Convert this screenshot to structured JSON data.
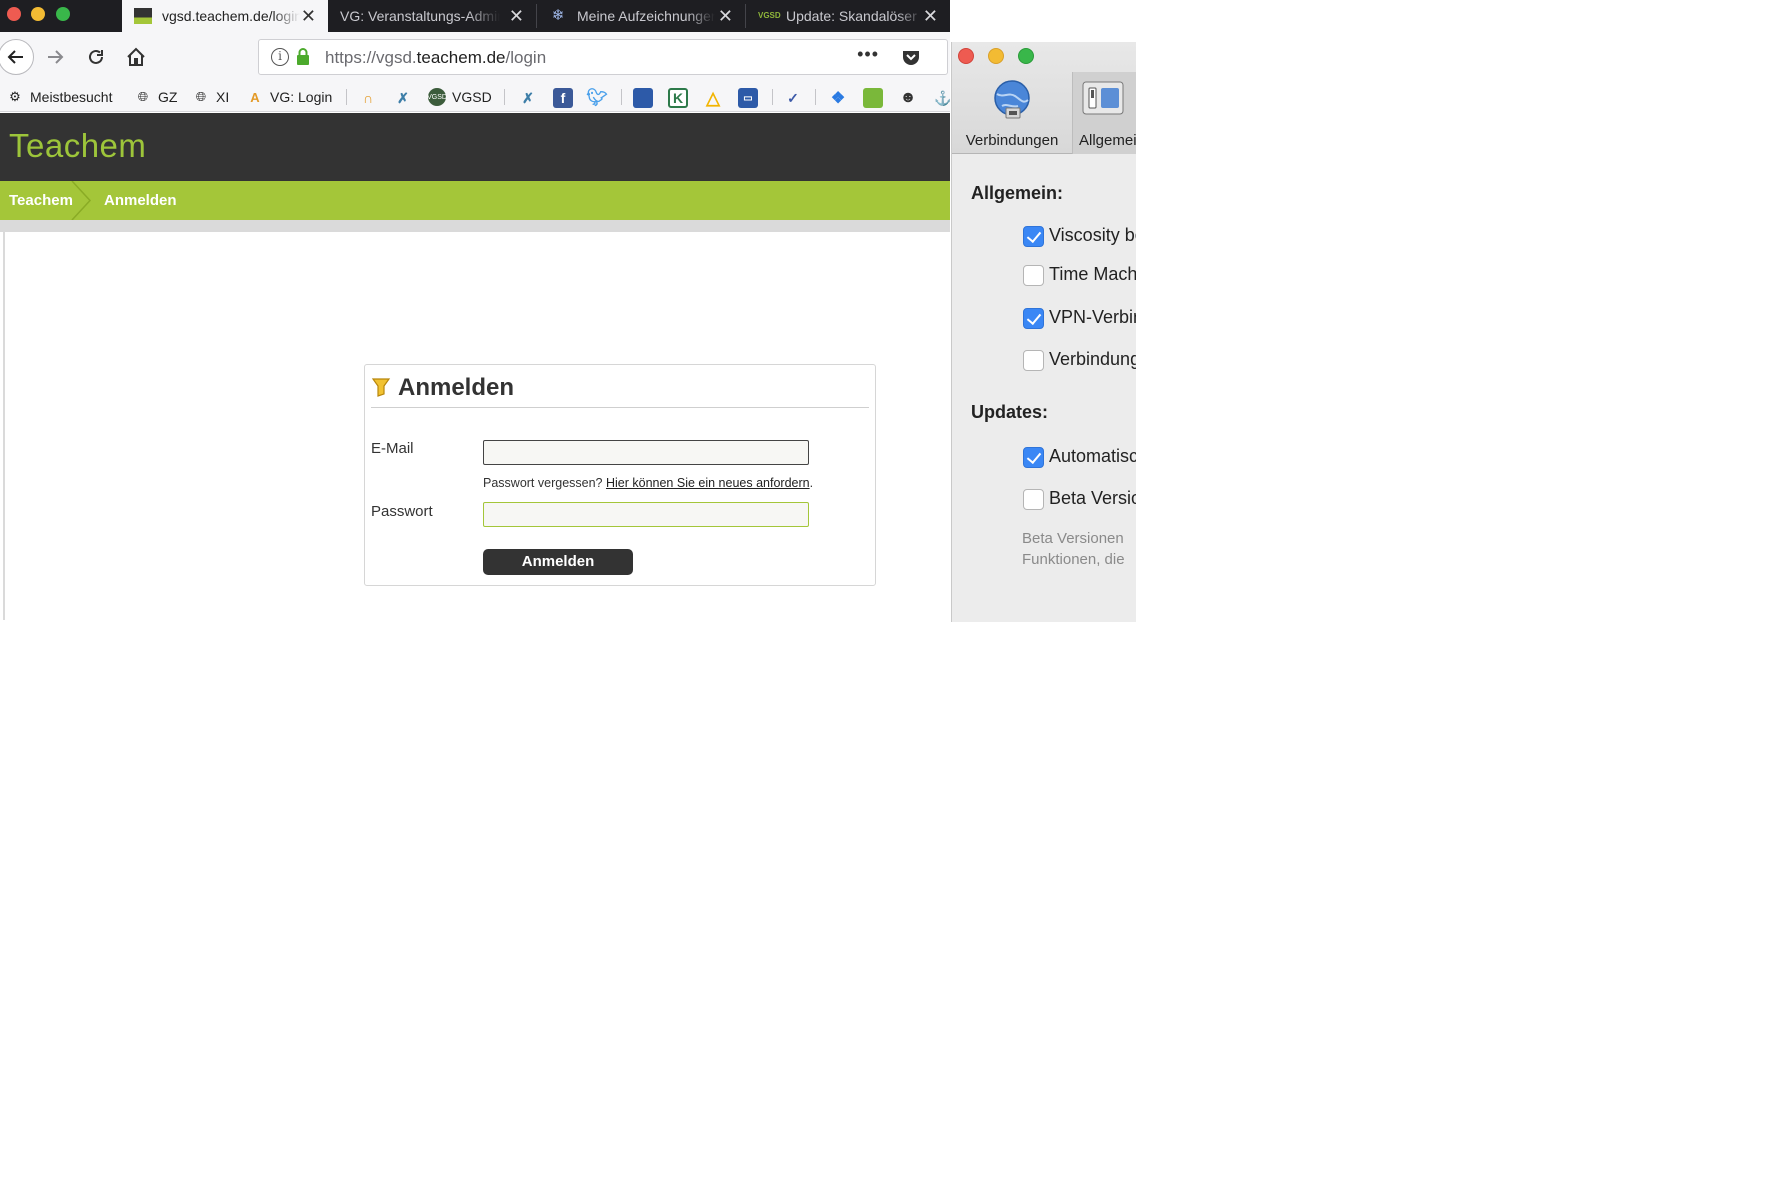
{
  "browser": {
    "tabs": [
      {
        "title": "vgsd.teachem.de/login",
        "active": true,
        "icon": "teachem-favicon"
      },
      {
        "title": "VG: Veranstaltungs-Admin",
        "active": false,
        "icon": "none"
      },
      {
        "title": "Meine Aufzeichnungen",
        "active": false,
        "icon": "snowflake-icon"
      },
      {
        "title": "Update: Skandalöser",
        "active": false,
        "icon": "vgsd-favicon"
      }
    ],
    "url": {
      "prefix": "https://vgsd.",
      "domain": "teachem.de",
      "path": "/login"
    },
    "url_more": "•••",
    "bookmarks": [
      {
        "label": "Meistbesucht",
        "icon": "gear-icon"
      },
      {
        "label": "GZ",
        "icon": "globe-icon"
      },
      {
        "label": "XI",
        "icon": "globe-icon"
      },
      {
        "label": "VG: Login",
        "icon": "vg-logo-icon"
      },
      {
        "label": "VGSD",
        "icon": "vgsd-logo-icon"
      }
    ]
  },
  "site": {
    "logo": "Teachem",
    "breadcrumb": [
      "Teachem",
      "Anmelden"
    ],
    "login": {
      "title": "Anmelden",
      "email_label": "E-Mail",
      "email_value": "",
      "forgot_text": "Passwort vergessen? ",
      "forgot_link": "Hier können Sie ein neues anfordern",
      "forgot_end": ".",
      "password_label": "Passwort",
      "password_value": "",
      "submit": "Anmelden"
    }
  },
  "prefs": {
    "toolbar": [
      {
        "label": "Verbindungen",
        "icon": "globe-network-icon"
      },
      {
        "label": "Allgemein",
        "icon": "switch-panel-icon",
        "selected": true
      }
    ],
    "general_heading": "Allgemein:",
    "general_items": [
      {
        "label": "Viscosity beim Anmelden öffnen",
        "checked": true
      },
      {
        "label": "Time Machine",
        "checked": false
      },
      {
        "label": "VPN-Verbindungen",
        "checked": true
      },
      {
        "label": "Verbindungen",
        "checked": false
      }
    ],
    "updates_heading": "Updates:",
    "update_items": [
      {
        "label": "Automatisch",
        "checked": true
      },
      {
        "label": "Beta Versionen",
        "checked": false
      }
    ],
    "beta_note_1": "Beta Versionen",
    "beta_note_2": "Funktionen, die"
  },
  "colors": {
    "brand_green": "#a4c639",
    "header_dark": "#333333",
    "checkbox_blue": "#3a87f5"
  }
}
